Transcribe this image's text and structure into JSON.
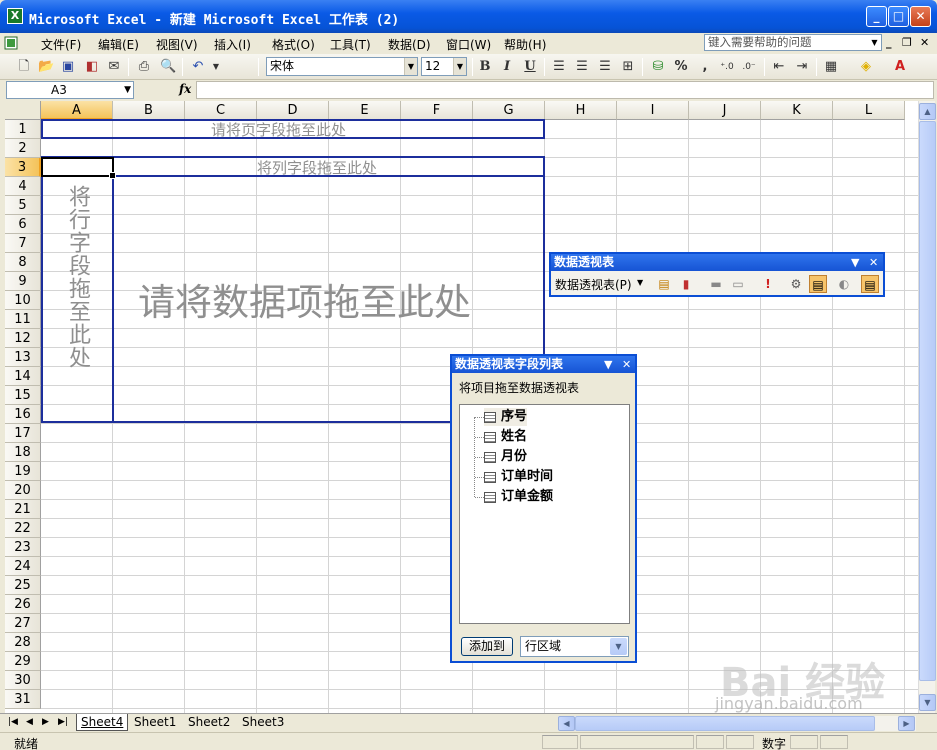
{
  "window": {
    "title": "Microsoft Excel - 新建 Microsoft Excel 工作表 (2)",
    "app_icon": "X",
    "min": "_",
    "max": "□",
    "close": "✕"
  },
  "menu": {
    "items": [
      "文件(F)",
      "编辑(E)",
      "视图(V)",
      "插入(I)",
      "格式(O)",
      "工具(T)",
      "数据(D)",
      "窗口(W)",
      "帮助(H)"
    ],
    "help_placeholder": "键入需要帮助的问题",
    "mdi_min": "_",
    "mdi_restore": "❐",
    "mdi_close": "✕"
  },
  "toolbar": {
    "font": "宋体",
    "size": "12",
    "bold": "B",
    "italic": "I",
    "underline": "U",
    "percent": "%",
    "comma": ","
  },
  "formula": {
    "name_box": "A3",
    "fx": "fx",
    "value": ""
  },
  "grid": {
    "columns": [
      "A",
      "B",
      "C",
      "D",
      "E",
      "F",
      "G",
      "H",
      "I",
      "J",
      "K",
      "L"
    ],
    "rows": [
      "1",
      "2",
      "3",
      "4",
      "5",
      "6",
      "7",
      "8",
      "9",
      "10",
      "11",
      "12",
      "13",
      "14",
      "15",
      "16",
      "17",
      "18",
      "19",
      "20",
      "21",
      "22",
      "23",
      "24",
      "25",
      "26",
      "27",
      "28",
      "29",
      "30",
      "31"
    ],
    "selected_col": "A",
    "selected_row": "3"
  },
  "pivot": {
    "page_drop": "请将页字段拖至此处",
    "col_drop": "将列字段拖至此处",
    "row_drop": "将行字段拖至此处",
    "data_drop": "请将数据项拖至此处"
  },
  "pivot_toolbar": {
    "title": "数据透视表",
    "menu_label": "数据透视表(P)",
    "dropdown": "▼",
    "close": "✕"
  },
  "field_list": {
    "title": "数据透视表字段列表",
    "hint": "将项目拖至数据透视表",
    "fields": [
      "序号",
      "姓名",
      "月份",
      "订单时间",
      "订单金额"
    ],
    "add_button": "添加到",
    "area": "行区域",
    "dropdown": "▼",
    "close": "✕"
  },
  "sheets": {
    "tabs": [
      "Sheet4",
      "Sheet1",
      "Sheet2",
      "Sheet3"
    ],
    "active": "Sheet4"
  },
  "status": {
    "left": "就绪",
    "numlock": "数字"
  },
  "watermark": {
    "brand": "Bai 经验",
    "url": "jingyan.baidu.com"
  }
}
